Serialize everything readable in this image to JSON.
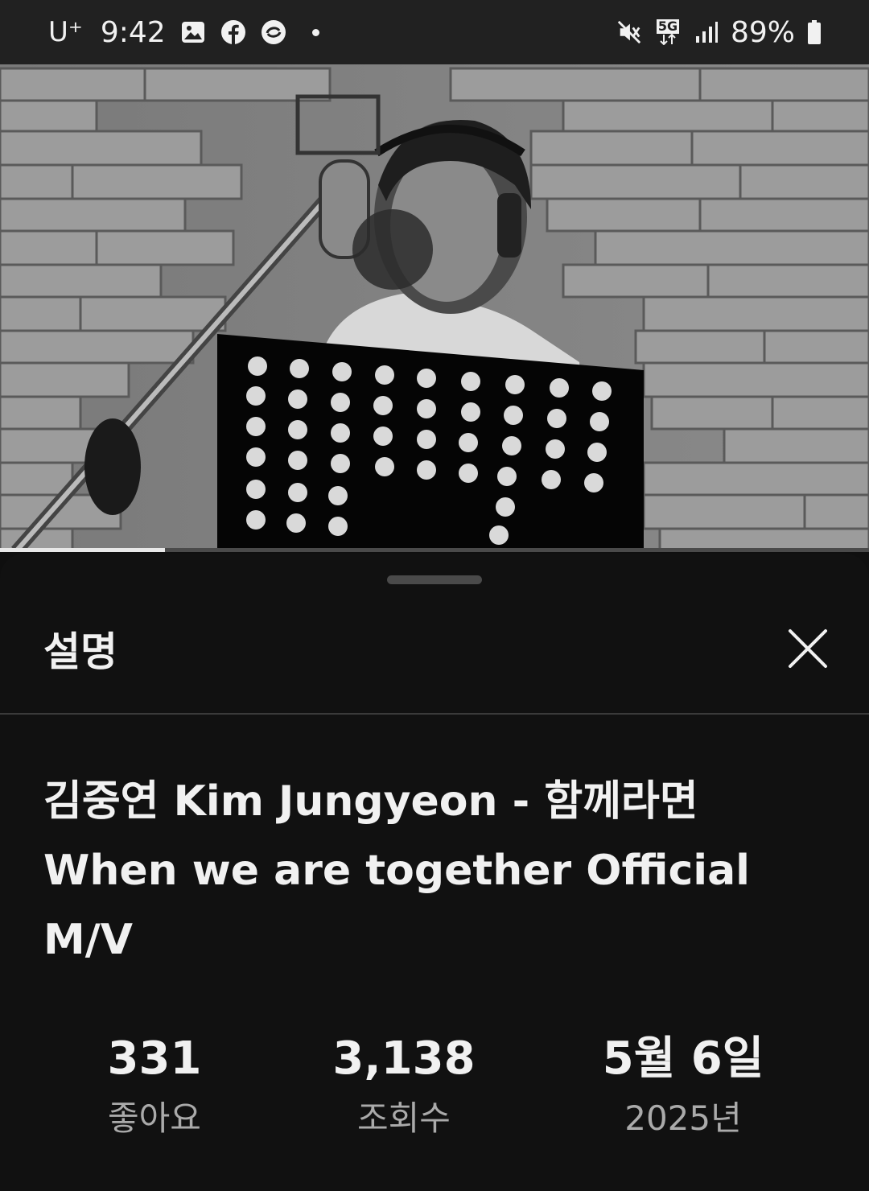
{
  "status_bar": {
    "carrier": "U⁺",
    "time": "9:42",
    "network": "5G",
    "battery": "89%",
    "icons": [
      "gallery-icon",
      "facebook-icon",
      "sync-app-icon",
      "notification-dot",
      "mute-icon",
      "5g-data-icon",
      "signal-bars-icon",
      "battery-icon"
    ]
  },
  "player": {
    "progress_fraction": 0.19
  },
  "sheet": {
    "title": "설명",
    "video_title": "김중연 Kim Jungyeon - 함께라면 When we are together Official M/V",
    "stats": {
      "likes": {
        "value": "331",
        "label": "좋아요"
      },
      "views": {
        "value": "3,138",
        "label": "조회수"
      },
      "date": {
        "value": "5월 6일",
        "label": "2025년"
      }
    }
  },
  "colors": {
    "background": "#0f0f0f",
    "status_bar": "#212121",
    "text_primary": "#f1f1f1",
    "text_secondary": "#aaaaaa",
    "divider": "#3a3a3a"
  }
}
